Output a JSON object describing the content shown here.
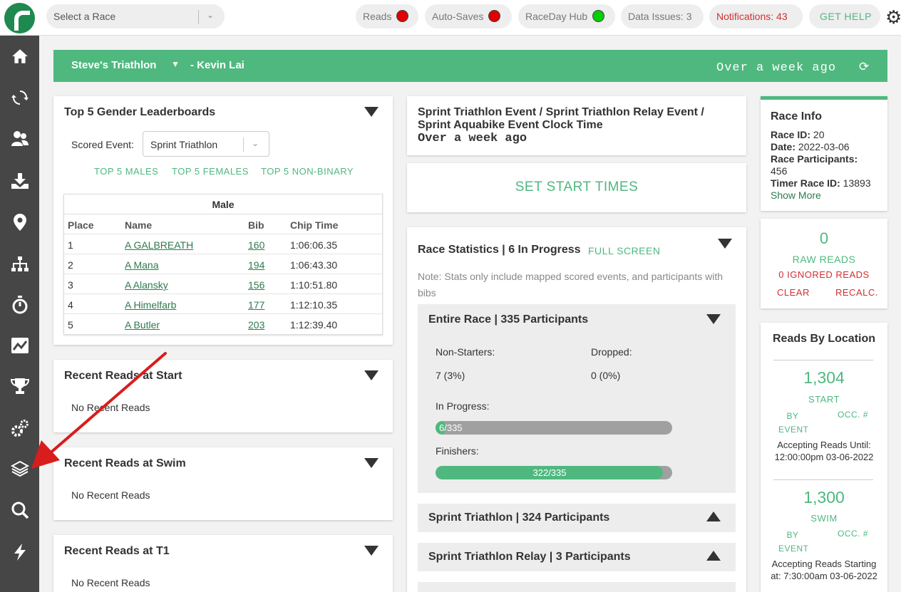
{
  "topbar": {
    "race_select_placeholder": "Select a Race",
    "reads_label": "Reads",
    "autosaves_label": "Auto-Saves",
    "raceday_label": "RaceDay Hub",
    "data_issues_label": "Data Issues: 3",
    "notifications_label": "Notifications: 43",
    "help_label": "GET HELP",
    "colors": {
      "red": "#e00000",
      "green": "#00d000",
      "notif": "#d03030",
      "help": "#4fb87f"
    }
  },
  "sidebar": {
    "icons": [
      "home-icon",
      "sync-icon",
      "users-icon",
      "download-icon",
      "location-pin-icon",
      "sitemap-icon",
      "stopwatch-icon",
      "chart-line-icon",
      "trophy-icon",
      "cogs-icon",
      "layers-icon",
      "search-icon",
      "bolt-icon"
    ]
  },
  "banner": {
    "event_name": "Steve's Triathlon",
    "user": "- Kevin Lai",
    "updated": "Over a week ago",
    "accent": "#4fb87f"
  },
  "leaderboard": {
    "title": "Top 5 Gender Leaderboards",
    "scored_event_label": "Scored Event:",
    "scored_event_value": "Sprint Triathlon",
    "tabs": [
      "TOP 5 MALES",
      "TOP 5 FEMALES",
      "TOP 5 NON-BINARY"
    ],
    "table_title": "Male",
    "columns": [
      "Place",
      "Name",
      "Bib",
      "Chip Time"
    ],
    "rows": [
      [
        "1",
        "A GALBREATH",
        "160",
        "1:06:06.35"
      ],
      [
        "2",
        "A Mana",
        "194",
        "1:06:43.30"
      ],
      [
        "3",
        "A Alansky",
        "156",
        "1:10:51.80"
      ],
      [
        "4",
        "A Himelfarb",
        "177",
        "1:12:10.35"
      ],
      [
        "5",
        "A Butler",
        "203",
        "1:12:39.40"
      ]
    ]
  },
  "recent_reads": [
    {
      "title": "Recent Reads at Start",
      "text": "No Recent Reads"
    },
    {
      "title": "Recent Reads at Swim",
      "text": "No Recent Reads"
    },
    {
      "title": "Recent Reads at T1",
      "text": "No Recent Reads"
    }
  ],
  "clock": {
    "title": "Sprint Triathlon Event / Sprint Triathlon Relay Event / Sprint Aquabike Event Clock Time",
    "value": "Over a week ago"
  },
  "start_times_label": "SET START TIMES",
  "stats": {
    "title": "Race Statistics | 6 In Progress",
    "fullscreen": "FULL SCREEN",
    "note": "Note: Stats only include mapped scored events, and participants with bibs",
    "entire": {
      "title": "Entire Race | 335 Participants",
      "non_starters_label": "Non-Starters:",
      "non_starters": "7 (3%)",
      "dropped_label": "Dropped:",
      "dropped": "0 (0%)",
      "in_progress_label": "In Progress:",
      "in_progress": "6/335",
      "in_progress_fraction": 0.018,
      "finishers_label": "Finishers:",
      "finishers": "322/335",
      "finishers_fraction": 0.961
    },
    "events": [
      "Sprint Triathlon | 324 Participants",
      "Sprint Triathlon Relay | 3 Participants"
    ]
  },
  "race_info": {
    "title": "Race Info",
    "id_label": "Race ID:",
    "id": " 20",
    "date_label": "Date:",
    "date": " 2022-03-06",
    "participants_label": "Race Participants:",
    "participants": "456",
    "timer_label": "Timer Race ID:",
    "timer": " 13893",
    "show_more": "Show More"
  },
  "raw_reads": {
    "count": "0",
    "label": "RAW READS",
    "ignored": "0 IGNORED READS",
    "clear": "CLEAR",
    "recalc": "RECALC."
  },
  "reads_by_location": {
    "title": "Reads By Location",
    "locations": [
      {
        "count": "1,304",
        "name": "START",
        "by_event": "BY EVENT",
        "occ": "OCC. #",
        "note": "Accepting Reads Until: 12:00:00pm 03-06-2022"
      },
      {
        "count": "1,300",
        "name": "SWIM",
        "by_event": "BY EVENT",
        "occ": "OCC. #",
        "note": "Accepting Reads Starting at: 7:30:00am 03-06-2022"
      }
    ]
  }
}
